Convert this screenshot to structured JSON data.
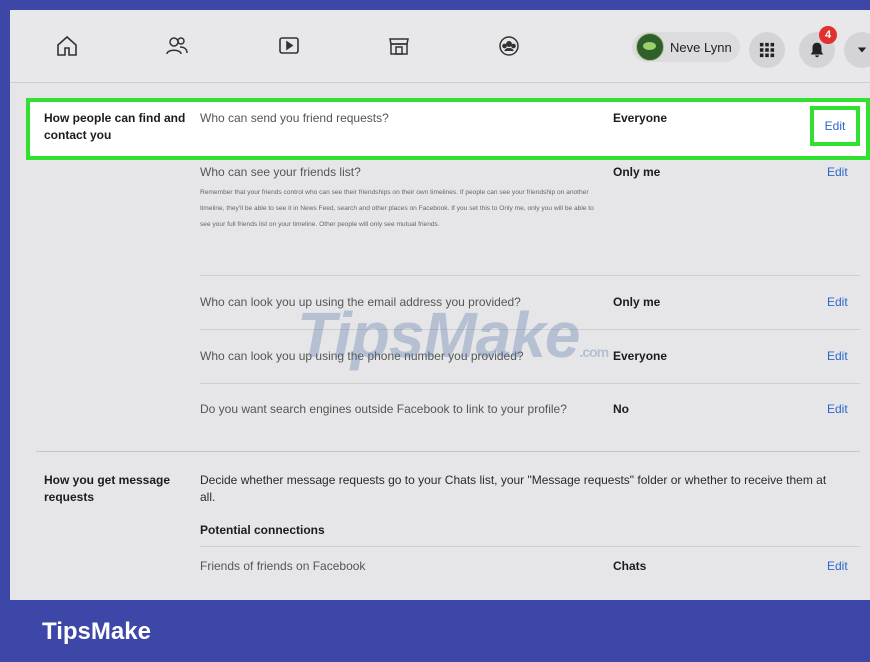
{
  "topbar": {
    "icons": [
      "home-icon",
      "friends-icon",
      "watch-icon",
      "marketplace-icon",
      "groups-icon"
    ],
    "profile_name": "Neve Lynn",
    "notification_count": "4"
  },
  "sections": {
    "find_contact": {
      "title": "How people can find and contact you",
      "rows": [
        {
          "question": "Who can send you friend requests?",
          "value": "Everyone",
          "edit": "Edit"
        },
        {
          "question": "Who can see your friends list?",
          "value": "Only me",
          "edit": "Edit",
          "description": "Remember that your friends control who can see their friendships on their own timelines. If people can see your friendship on another timeline, they'll be able to see it in News Feed, search and other places on Facebook. If you set this to Only me, only you will be able to see your full friends list on your timeline. Other people will only see mutual friends."
        },
        {
          "question": "Who can look you up using the email address you provided?",
          "value": "Only me",
          "edit": "Edit"
        },
        {
          "question": "Who can look you up using the phone number you provided?",
          "value": "Everyone",
          "edit": "Edit"
        },
        {
          "question": "Do you want search engines outside Facebook to link to your profile?",
          "value": "No",
          "edit": "Edit"
        }
      ]
    },
    "message_requests": {
      "title": "How you get message requests",
      "description": "Decide whether message requests go to your Chats list, your \"Message requests\" folder or whether to receive them at all.",
      "subheading": "Potential connections",
      "rows": [
        {
          "question": "Friends of friends on Facebook",
          "value": "Chats",
          "edit": "Edit"
        }
      ]
    }
  },
  "watermark": {
    "text": "TipsMake",
    "suffix": ".com"
  },
  "footer": {
    "brand": "TipsMake"
  },
  "colors": {
    "highlight": "#31e12f",
    "link": "#2a67c9",
    "brand_bg": "#3c47a8",
    "badge": "#e0312d"
  }
}
